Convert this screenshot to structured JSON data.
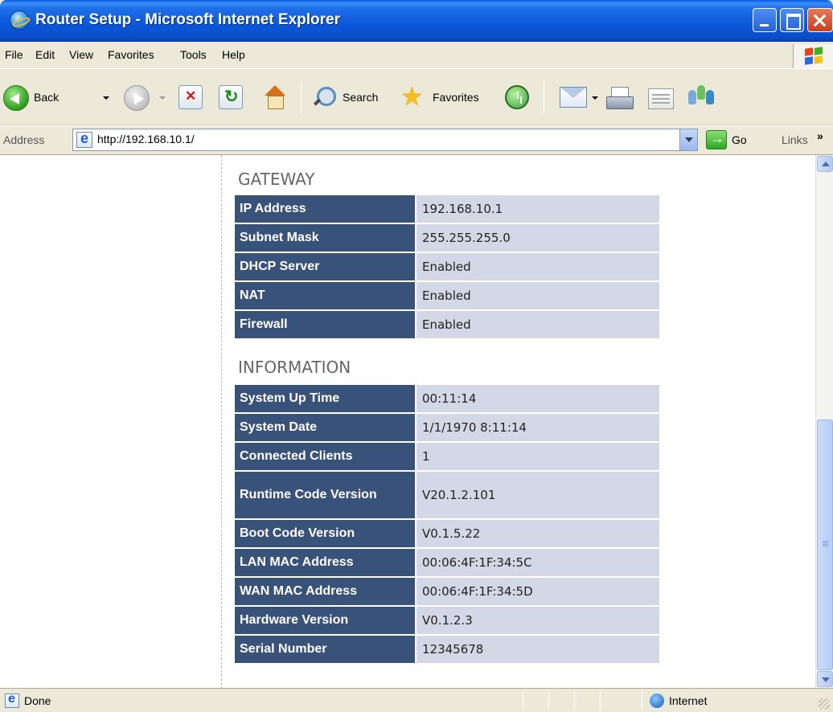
{
  "window": {
    "title": "Router Setup - Microsoft Internet Explorer"
  },
  "menubar": {
    "items": [
      "File",
      "Edit",
      "View",
      "Favorites",
      "Tools",
      "Help"
    ]
  },
  "toolbar": {
    "back_label": "Back",
    "search_label": "Search",
    "favorites_label": "Favorites"
  },
  "addressbar": {
    "label": "Address",
    "url": "http://192.168.10.1/",
    "go_label": "Go",
    "links_label": "Links",
    "links_more": "»"
  },
  "gateway": {
    "title": "GATEWAY",
    "rows": [
      {
        "label": "IP Address",
        "value": "192.168.10.1"
      },
      {
        "label": "Subnet Mask",
        "value": "255.255.255.0"
      },
      {
        "label": "DHCP Server",
        "value": "Enabled"
      },
      {
        "label": "NAT",
        "value": "Enabled"
      },
      {
        "label": "Firewall",
        "value": "Enabled"
      }
    ]
  },
  "information": {
    "title": "INFORMATION",
    "rows": [
      {
        "label": "System Up Time",
        "value": "00:11:14"
      },
      {
        "label": "System Date",
        "value": "1/1/1970 8:11:14"
      },
      {
        "label": "Connected Clients",
        "value": "1"
      },
      {
        "label": "Runtime Code Version",
        "value": "V20.1.2.101"
      },
      {
        "label": "Boot Code Version",
        "value": "V0.1.5.22"
      },
      {
        "label": "LAN MAC Address",
        "value": "00:06:4F:1F:34:5C"
      },
      {
        "label": "WAN MAC Address",
        "value": "00:06:4F:1F:34:5D"
      },
      {
        "label": "Hardware Version",
        "value": "V0.1.2.3"
      },
      {
        "label": "Serial Number",
        "value": "12345678"
      }
    ]
  },
  "statusbar": {
    "status": "Done",
    "zone": "Internet"
  },
  "colors": {
    "titlebar": "#0b57d9",
    "label_cell": "#39527a",
    "value_cell": "#d4d7e6",
    "chrome": "#ece9d8"
  }
}
